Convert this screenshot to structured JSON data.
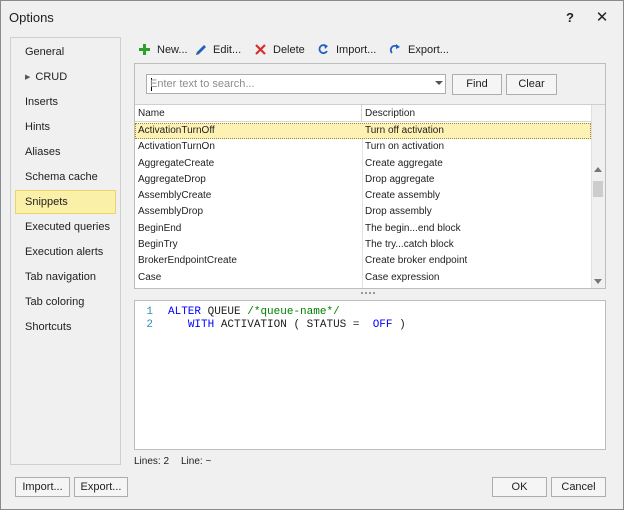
{
  "window": {
    "title": "Options",
    "help_label": "?",
    "close_label": "✕"
  },
  "sidebar": {
    "items": [
      {
        "label": "General"
      },
      {
        "label": "CRUD"
      },
      {
        "label": "Inserts"
      },
      {
        "label": "Hints"
      },
      {
        "label": "Aliases"
      },
      {
        "label": "Schema cache"
      },
      {
        "label": "Snippets"
      },
      {
        "label": "Executed queries"
      },
      {
        "label": "Execution alerts"
      },
      {
        "label": "Tab navigation"
      },
      {
        "label": "Tab coloring"
      },
      {
        "label": "Shortcuts"
      }
    ],
    "selected": "Snippets"
  },
  "toolbar": {
    "new_label": "New...",
    "edit_label": "Edit...",
    "delete_label": "Delete",
    "import_label": "Import...",
    "export_label": "Export..."
  },
  "search": {
    "placeholder": "Enter text to search...",
    "value": "",
    "find_label": "Find",
    "clear_label": "Clear"
  },
  "grid": {
    "columns": [
      "Name",
      "Description"
    ],
    "rows": [
      {
        "name": "ActivationTurnOff",
        "desc": "Turn off activation"
      },
      {
        "name": "ActivationTurnOn",
        "desc": "Turn on activation"
      },
      {
        "name": "AggregateCreate",
        "desc": "Create aggregate"
      },
      {
        "name": "AggregateDrop",
        "desc": "Drop aggregate"
      },
      {
        "name": "AssemblyCreate",
        "desc": "Create assembly"
      },
      {
        "name": "AssemblyDrop",
        "desc": "Drop assembly"
      },
      {
        "name": "BeginEnd",
        "desc": "The begin...end block"
      },
      {
        "name": "BeginTry",
        "desc": "The try...catch block"
      },
      {
        "name": "BrokerEndpointCreate",
        "desc": "Create broker endpoint"
      },
      {
        "name": "Case",
        "desc": "Case expression"
      }
    ],
    "selected_row": "ActivationTurnOff"
  },
  "editor": {
    "line_numbers": [
      "1",
      "2"
    ],
    "line1": {
      "kw1": "ALTER",
      "tx1": "QUEUE",
      "comment": "/*queue-name*/"
    },
    "line2": {
      "kw1": "WITH",
      "tx1": "ACTIVATION",
      "tx2": "(",
      "tx3": "STATUS",
      "tx4": "=",
      "kw2": "OFF",
      "tx5": ")"
    }
  },
  "status": {
    "lines": "Lines: 2",
    "line": "Line: ~"
  },
  "footer": {
    "import_label": "Import...",
    "export_label": "Export...",
    "ok_label": "OK",
    "cancel_label": "Cancel"
  },
  "colors": {
    "selection_bg": "#fdf1b3",
    "keyword": "#0000ff",
    "comment": "#008000",
    "line_number": "#2b91af",
    "new_icon": "#2ca02c",
    "delete_icon": "#d32f2f",
    "edit_icon": "#1f5fbf"
  }
}
